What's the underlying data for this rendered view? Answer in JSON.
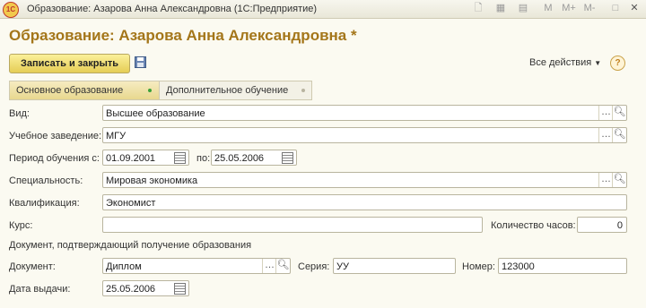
{
  "window": {
    "app_logo": "1С",
    "title": "Образование: Азарова Анна Александровна  (1С:Предприятие)",
    "controls": [
      "M",
      "M+",
      "M-",
      "□",
      "✕"
    ]
  },
  "form": {
    "heading": "Образование: Азарова Анна Александровна *",
    "save_close": "Записать и закрыть",
    "all_actions": "Все действия",
    "help": "?"
  },
  "tabs": [
    "Основное образование",
    "Дополнительное обучение"
  ],
  "fields": {
    "vid": {
      "label": "Вид:",
      "value": "Высшее образование"
    },
    "institution": {
      "label": "Учебное заведение:",
      "value": "МГУ"
    },
    "period": {
      "label": "Период обучения с:",
      "from": "01.09.2001",
      "to_label": "по:",
      "to": "25.05.2006"
    },
    "specialty": {
      "label": "Специальность:",
      "value": "Мировая экономика"
    },
    "qualification": {
      "label": "Квалификация:",
      "value": "Экономист"
    },
    "course": {
      "label": "Курс:",
      "value": ""
    },
    "hours": {
      "label": "Количество часов:",
      "value": "0"
    },
    "doc_section": "Документ, подтверждающий получение образования",
    "document": {
      "label": "Документ:",
      "value": "Диплом"
    },
    "series": {
      "label": "Серия:",
      "value": "УУ"
    },
    "number": {
      "label": "Номер:",
      "value": "123000"
    },
    "issue_date": {
      "label": "Дата выдачи:",
      "value": "25.05.2006"
    }
  },
  "colors": {
    "accent": "#a4761a",
    "primary_button": "#f1de72",
    "tab_indicator": "#3aa13a"
  }
}
